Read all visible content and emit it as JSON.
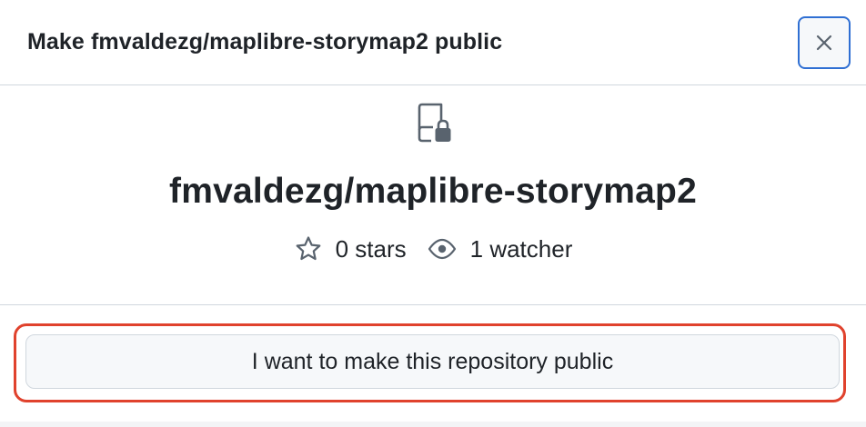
{
  "dialog": {
    "title": "Make fmvaldezg/maplibre-storymap2 public",
    "close_icon": "x-icon"
  },
  "repo": {
    "icon": "repo-locked-icon",
    "name": "fmvaldezg/maplibre-storymap2",
    "stars_label": "0 stars",
    "watchers_label": "1 watcher"
  },
  "footer": {
    "confirm_label": "I want to make this repository public"
  },
  "colors": {
    "focus_ring": "#2f6fd3",
    "highlight": "#e0422d",
    "text": "#1f2328",
    "muted_icon": "#59636e"
  }
}
